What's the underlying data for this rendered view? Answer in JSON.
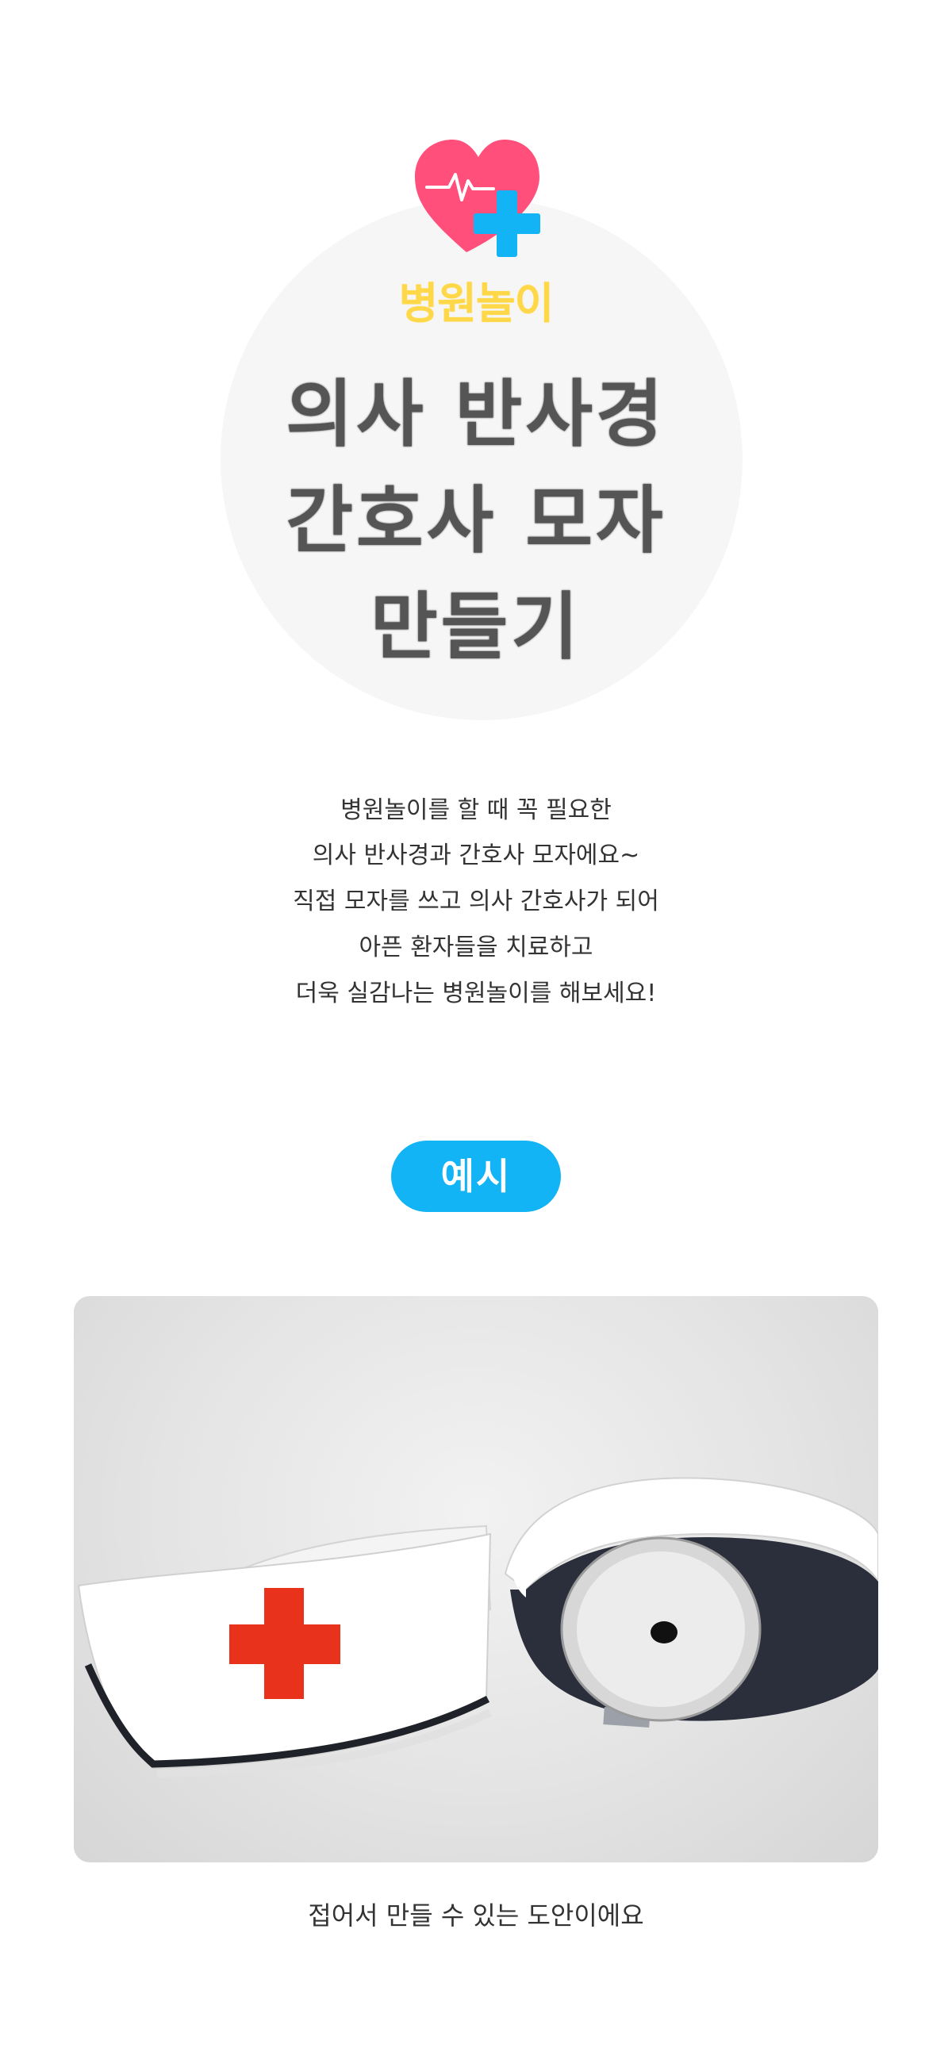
{
  "hero": {
    "icon": "heart-pulse-plus-icon",
    "category": "병원놀이",
    "title_lines": [
      "의사 반사경",
      "간호사 모자",
      "만들기"
    ]
  },
  "description": {
    "lines": [
      "병원놀이를 할 때 꼭 필요한",
      "의사 반사경과 간호사 모자에요~",
      "직접 모자를 쓰고 의사 간호사가 되어",
      "아픈 환자들을 치료하고",
      "더욱 실감나는 병원놀이를 해보세요!"
    ]
  },
  "example": {
    "label": "예시",
    "photo": "nurse-hat-and-head-mirror-photo",
    "caption": "접어서 만들 수 있는 도안이에요"
  },
  "colors": {
    "heart": "#ff4f7a",
    "plus": "#12b4f5",
    "category": "#ffd84a",
    "title": "#555555",
    "pill": "#12b4f5",
    "red_cross": "#e8321c"
  }
}
